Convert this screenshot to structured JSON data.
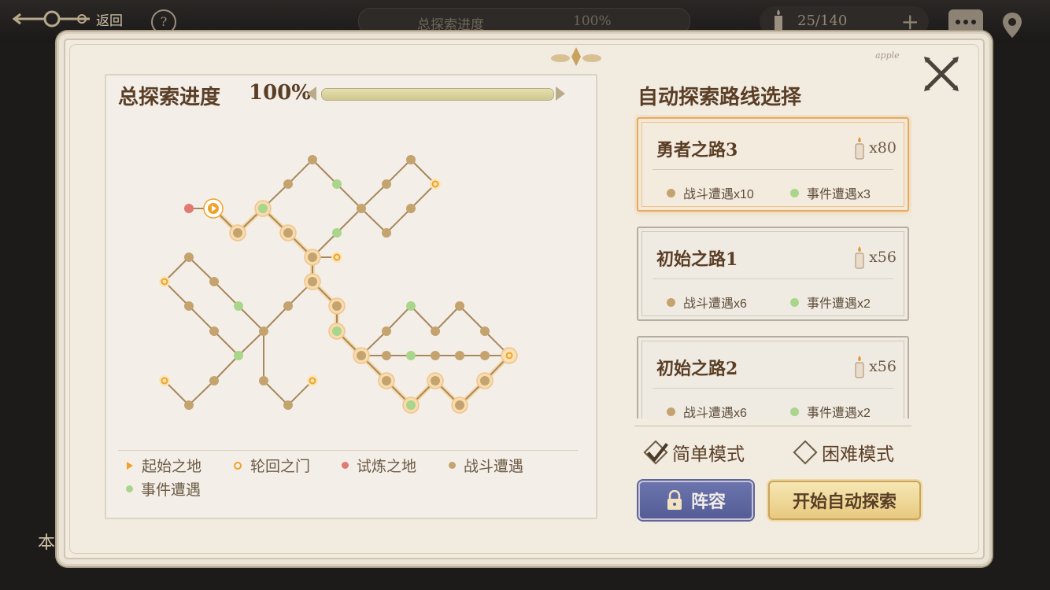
{
  "topbar": {
    "back_label": "返回",
    "help_label": "?",
    "progress_label": "总探索进度",
    "progress_value": "100%",
    "currency_value": "25/140",
    "currency_plus": "+"
  },
  "side_text": "本",
  "panel": {
    "signature": "apple",
    "progress_label": "总探索进度",
    "progress_value": "100%",
    "progress_fraction": 1.0
  },
  "legend": {
    "start": "起始之地",
    "portal": "轮回之门",
    "trial": "试炼之地",
    "battle": "战斗遭遇",
    "event": "事件遭遇"
  },
  "colors": {
    "battle": "#c4a36f",
    "event": "#a9d68a",
    "trial": "#e07a73",
    "portal": "#f2b75b",
    "start": "#f0a22a",
    "path": "#a8885c",
    "path_selected": "#f6d9a8"
  },
  "routes": {
    "title": "自动探索路线选择",
    "items": [
      {
        "name": "勇者之路3",
        "cost": "x80",
        "battle": "战斗遭遇x10",
        "event": "事件遭遇x3",
        "selected": true
      },
      {
        "name": "初始之路1",
        "cost": "x56",
        "battle": "战斗遭遇x6",
        "event": "事件遭遇x2",
        "selected": false
      },
      {
        "name": "初始之路2",
        "cost": "x56",
        "battle": "战斗遭遇x6",
        "event": "事件遭遇x2",
        "selected": false
      }
    ]
  },
  "modes": {
    "easy": "简单模式",
    "hard": "困难模式",
    "selected": "easy"
  },
  "buttons": {
    "lineup": "阵容",
    "start": "开始自动探索"
  }
}
